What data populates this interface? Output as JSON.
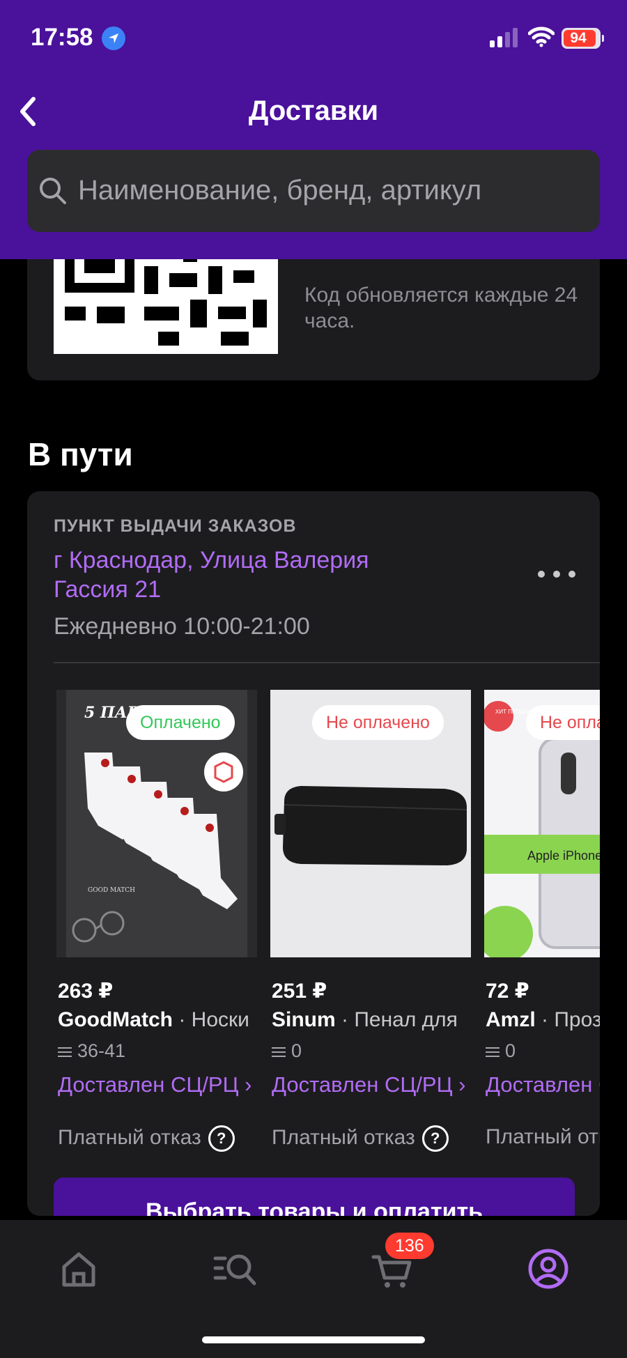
{
  "status_bar": {
    "time": "17:58",
    "battery": "94"
  },
  "header": {
    "title": "Доставки"
  },
  "search": {
    "placeholder": "Наименование, бренд, артикул"
  },
  "qr_card": {
    "note": "Код обновляется каждые 24 часа."
  },
  "in_transit": {
    "title": "В пути",
    "pickup": {
      "label": "ПУНКТ ВЫДАЧИ ЗАКАЗОВ",
      "address": "г Краснодар, Улица Валерия Гассия 21",
      "hours": "Ежедневно 10:00-21:00"
    },
    "products": [
      {
        "badge": "Оплачено",
        "badge_color": "#34c759",
        "price": "263 ₽",
        "brand": "GoodMatch",
        "name": " · Носки",
        "size": "36-41",
        "status": "Доставлен СЦ/РЦ ›",
        "refund": "Платный отказ"
      },
      {
        "badge": "Не оплачено",
        "badge_color": "#e5484d",
        "price": "251 ₽",
        "brand": "Sinum",
        "name": " · Пенал для",
        "size": "0",
        "status": "Доставлен СЦ/РЦ ›",
        "refund": "Платный отказ"
      },
      {
        "badge": "Не оплачено",
        "badge_color": "#e5484d",
        "price": "72 ₽",
        "brand": "Amzl",
        "name": " · Прозрачный",
        "size": "0",
        "status": "Доставлен СЦ/РЦ ›",
        "refund": "Платный отказ",
        "image_text": "Apple iPhone",
        "sticker": "ХИТ ПРОДАЖ"
      }
    ],
    "cta": "Выбрать товары и оплатить"
  },
  "tabbar": {
    "items": [
      "home-icon",
      "catalog-search-icon",
      "cart-icon",
      "profile-icon"
    ],
    "cart_count": "136",
    "active_color": "#b16cf5"
  }
}
